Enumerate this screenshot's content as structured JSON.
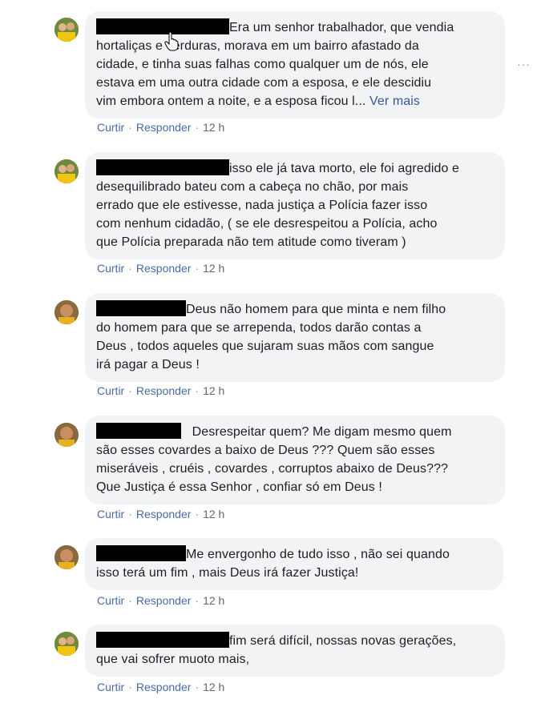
{
  "comments": [
    {
      "lines": [
        "Era um senhor trabalhador, que vendia",
        "hortaliças e verduras, morava em um bairro afastado da",
        "cidade, e tinha suas falhas como qualquer um de nós, ele",
        "estava em uma outra cidade com a esposa, e ele descidiu",
        "vim embora ontem a noite, e a esposa ficou l..."
      ],
      "see_more": "Ver mais",
      "like": "Curtir",
      "reply": "Responder",
      "time": "12 h",
      "avatar_icon": "profile-photo-icon"
    },
    {
      "lines": [
        "isso ele já tava morto, ele foi agredido e",
        "desequilibrado bateu com a cabeça no chão, por mais",
        "errado que ele estivesse, nada justiça a Polícia fazer isso",
        "com nenhum cidadão, ( se ele desrespeitou a Polícia, acho",
        "que Polícia preparada não tem atitude como tiveram )"
      ],
      "like": "Curtir",
      "reply": "Responder",
      "time": "12 h",
      "avatar_icon": "profile-photo-icon"
    },
    {
      "lines": [
        "Deus não homem para que minta e nem filho",
        "do homem para que se arrependa, todos darão contas a",
        "Deus , todos aqueles que sujaram suas mãos com sangue",
        "irá pagar a Deus !"
      ],
      "like": "Curtir",
      "reply": "Responder",
      "time": "12 h",
      "avatar_icon": "profile-photo-icon"
    },
    {
      "lines": [
        "Desrespeitar quem? Me digam mesmo quem",
        "são esses covardes a baixo de Deus ??? Quem são esses",
        "miseráveis , cruéis , covardes , corruptos abaixo de Deus???",
        "Que Justiça é essa Senhor , confiar só em Deus !"
      ],
      "like": "Curtir",
      "reply": "Responder",
      "time": "12 h",
      "avatar_icon": "profile-photo-icon"
    },
    {
      "lines": [
        "Me envergonho de tudo isso , não sei quando",
        "isso terá um fim , mais Deus irá fazer Justiça!"
      ],
      "like": "Curtir",
      "reply": "Responder",
      "time": "12 h",
      "avatar_icon": "profile-photo-icon"
    },
    {
      "lines": [
        "fim será difícil, nossas novas gerações,",
        "que vai sofrer muoto mais,"
      ],
      "like": "Curtir",
      "reply": "Responder",
      "time": "12 h",
      "avatar_icon": "profile-photo-icon"
    }
  ],
  "options_label": "···",
  "cursor_icon": "hand-pointer-icon",
  "colors": {
    "bubble_bg": "#f2f3f5",
    "link": "#4b6aa5",
    "see_more": "#385898",
    "meta_text": "#606770",
    "redaction": "#000000"
  }
}
